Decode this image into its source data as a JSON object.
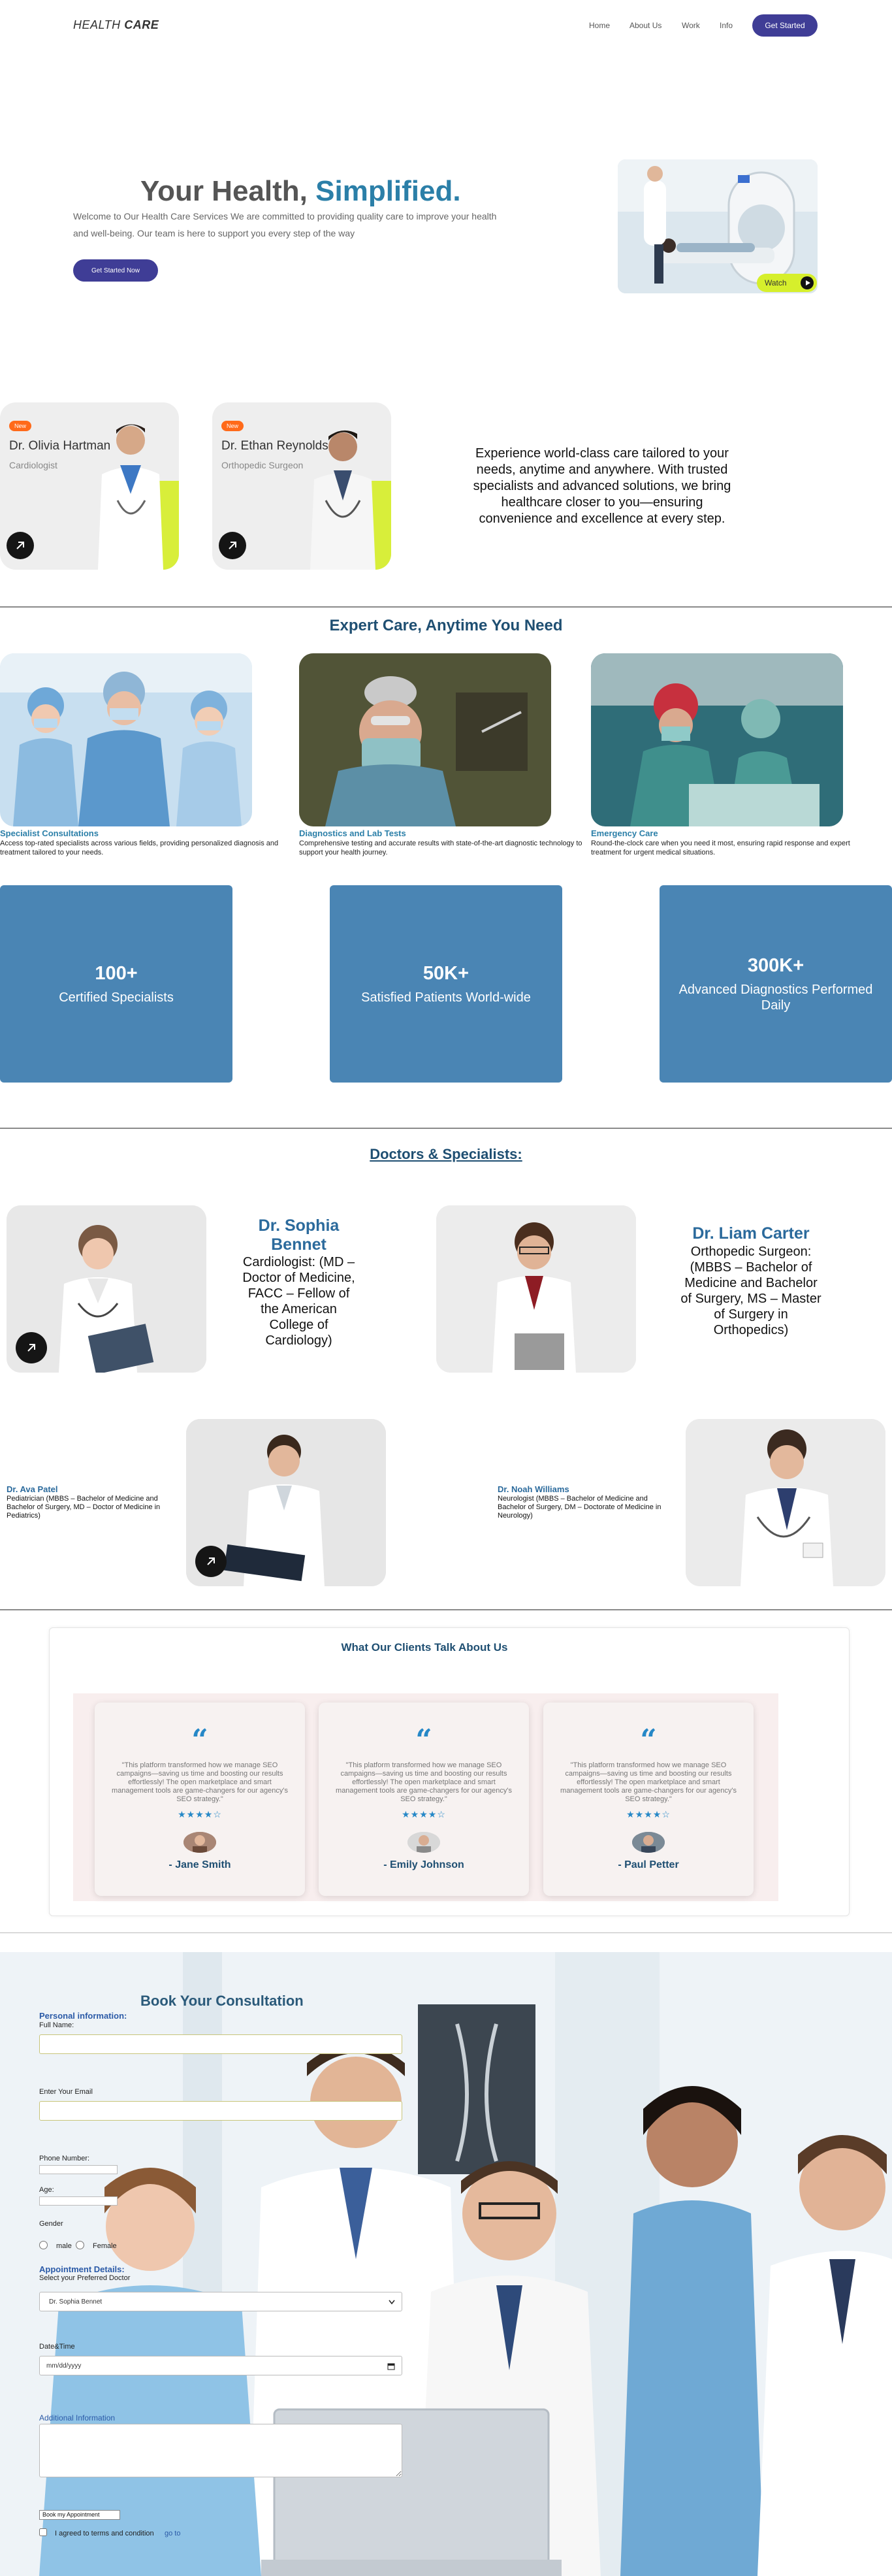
{
  "nav": {
    "logo_a": "HEALTH",
    "logo_b": "CARE",
    "links": [
      "Home",
      "About Us",
      "Work",
      "Info"
    ],
    "cta": "Get Started"
  },
  "hero": {
    "title_a": "Your Health,",
    "title_b": "Simplified.",
    "text": "Welcome to Our Health Care Services We are committed to providing quality care to improve your health and well-being. Our team is here to support you every step of the way",
    "cta": "Get Started Now",
    "watch": "Watch"
  },
  "featured": [
    {
      "badge": "New",
      "name": "Dr. Olivia Hartman",
      "spec": "Cardiologist"
    },
    {
      "badge": "New",
      "name": "Dr. Ethan Reynolds",
      "spec": "Orthopedic Surgeon"
    }
  ],
  "intro_text": "Experience world-class care tailored to your needs, anytime and anywhere. With trusted specialists and advanced solutions, we bring healthcare closer to you—ensuring convenience and excellence at every step.",
  "expert": {
    "title": "Expert Care, Anytime You Need",
    "services": [
      {
        "title": "Specialist Consultations",
        "desc": "Access top-rated specialists across various fields, providing personalized diagnosis and treatment tailored to your needs."
      },
      {
        "title": "Diagnostics and Lab Tests",
        "desc": "Comprehensive testing and accurate results with state-of-the-art diagnostic technology to support your health journey."
      },
      {
        "title": "Emergency Care",
        "desc": "Round-the-clock care when you need it most, ensuring rapid response and expert treatment for urgent medical situations."
      }
    ]
  },
  "stats": [
    {
      "number": "100+",
      "label": "Certified Specialists"
    },
    {
      "number": "50K+",
      "label": "Satisfied Patients World-wide"
    },
    {
      "number": "300K+",
      "label": "Advanced Diagnostics Performed Daily"
    }
  ],
  "specialists": {
    "title": "Doctors & Specialists:",
    "large": [
      {
        "name": "Dr. Sophia Bennet",
        "desc": "Cardiologist: (MD – Doctor of Medicine, FACC – Fellow of the American College of Cardiology)"
      },
      {
        "name": "Dr. Liam Carter",
        "desc": "Orthopedic Surgeon: (MBBS – Bachelor of Medicine and Bachelor of Surgery, MS – Master of Surgery in Orthopedics)"
      }
    ],
    "small": [
      {
        "name": "Dr. Ava Patel",
        "desc": "Pediatrician (MBBS – Bachelor of Medicine and Bachelor of Surgery, MD – Doctor of Medicine in Pediatrics)"
      },
      {
        "name": "Dr. Noah Williams",
        "desc": "Neurologist (MBBS – Bachelor of Medicine and Bachelor of Surgery, DM – Doctorate of Medicine in Neurology)"
      }
    ]
  },
  "testimonials": {
    "title": "What Our Clients Talk About Us",
    "items": [
      {
        "text": "\"This platform transformed how we manage SEO campaigns—saving us time and boosting our results effortlessly! The open marketplace and smart management tools are game-changers for our agency's SEO strategy.\"",
        "stars": "★★★★☆",
        "name": "- Jane Smith"
      },
      {
        "text": "\"This platform transformed how we manage SEO campaigns—saving us time and boosting our results effortlessly! The open marketplace and smart management tools are game-changers for our agency's SEO strategy.\"",
        "stars": "★★★★☆",
        "name": "- Emily Johnson"
      },
      {
        "text": "\"This platform transformed how we manage SEO campaigns—saving us time and boosting our results effortlessly! The open marketplace and smart management tools are game-changers for our agency's SEO strategy.\"",
        "stars": "★★★★☆",
        "name": "- Paul Petter"
      }
    ]
  },
  "consult": {
    "title": "Book Your Consultation",
    "personal": "Personal information:",
    "full_name": "Full Name:",
    "email": "Enter Your Email",
    "phone": "Phone Number:",
    "age": "Age:",
    "gender": "Gender",
    "male": "male",
    "female": "Female",
    "appointment": "Appointment Details:",
    "select_doctor": "Select your Preferred Doctor",
    "doctor_value": "Dr. Sophia Bennet",
    "datetime": "Date&Time",
    "datetime_value": "mm/dd/yyyy",
    "additional": "Additional Information",
    "book_btn": "Book my Appointment",
    "agree": "I agreed to terms and condition",
    "agree_link": "go to"
  }
}
